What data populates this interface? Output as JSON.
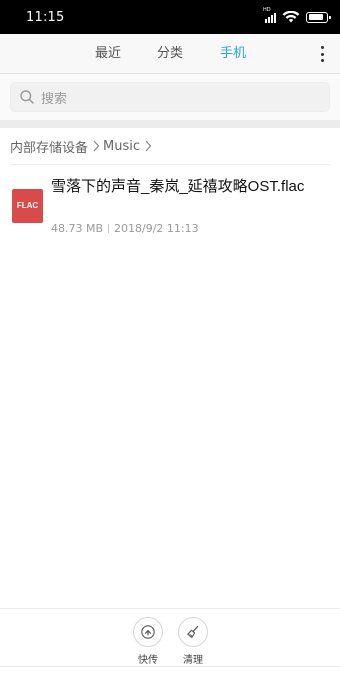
{
  "status_bar": {
    "time": "11:15",
    "network_label": "HD",
    "battery_level": 0.85
  },
  "tabs": [
    {
      "label": "最近",
      "active": false
    },
    {
      "label": "分类",
      "active": false
    },
    {
      "label": "手机",
      "active": true
    }
  ],
  "accent_color": "#2aa6d9",
  "search": {
    "placeholder": "搜索"
  },
  "breadcrumb": [
    "内部存储设备",
    "Music"
  ],
  "files": [
    {
      "icon_label": "FLAC",
      "icon_color": "#d94a4a",
      "name": "雪落下的声音_秦岚_延禧攻略OST.flac",
      "size": "48.73 MB",
      "modified": "2018/9/2 11:13"
    }
  ],
  "bottom_actions": [
    {
      "label": "快传",
      "icon": "share-transfer-icon"
    },
    {
      "label": "清理",
      "icon": "broom-clean-icon"
    }
  ]
}
